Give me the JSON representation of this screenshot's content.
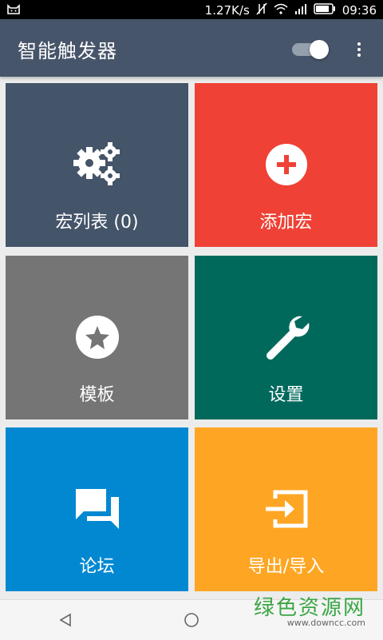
{
  "status_bar": {
    "speed": "1.27K/s",
    "time": "09:36",
    "icons": [
      "cat-notification-icon",
      "data-off-icon",
      "wifi-icon",
      "signal-icon",
      "battery-icon"
    ]
  },
  "app_bar": {
    "title": "智能触发器",
    "toggle_on": true,
    "icons": [
      "toggle-switch",
      "overflow-menu-icon"
    ]
  },
  "tiles": [
    {
      "label": "宏列表 (0)",
      "icon": "gears-icon",
      "color": "#445469"
    },
    {
      "label": "添加宏",
      "icon": "add-circle-icon",
      "color": "#ef4135"
    },
    {
      "label": "模板",
      "icon": "star-circle-icon",
      "color": "#757575"
    },
    {
      "label": "设置",
      "icon": "wrench-icon",
      "color": "#00695c"
    },
    {
      "label": "论坛",
      "icon": "forum-chat-icon",
      "color": "#0288d1"
    },
    {
      "label": "导出/导入",
      "icon": "import-export-icon",
      "color": "#fea623"
    }
  ],
  "watermark": {
    "text": "绿色资源网",
    "url_text": "www.downcc.com"
  },
  "nav_bar": {
    "icons": [
      "back-icon",
      "home-icon"
    ]
  }
}
